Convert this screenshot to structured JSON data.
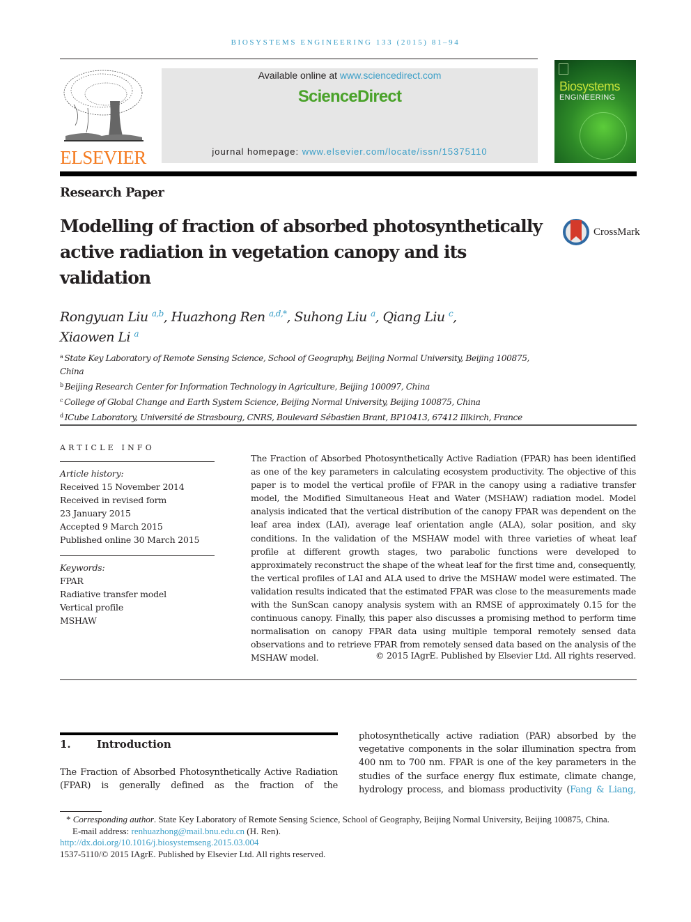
{
  "journal_ref": "BIOSYSTEMS ENGINEERING 133 (2015) 81–94",
  "header": {
    "publisher_logo_text": "ELSEVIER",
    "available_prefix": "Available online at ",
    "available_link": "www.sciencedirect.com",
    "brand": "ScienceDirect",
    "homepage_prefix": "journal homepage: ",
    "homepage_link": "www.elsevier.com/locate/issn/15375110",
    "cover_title_line1": "Biosystems",
    "cover_title_line2": "ENGINEERING"
  },
  "article_type": "Research Paper",
  "title": "Modelling of fraction of absorbed photosynthetically active radiation in vegetation canopy and its validation",
  "crossmark_label": "CrossMark",
  "authors": [
    {
      "name": "Rongyuan Liu",
      "affil": "a,b",
      "sep": ", "
    },
    {
      "name": "Huazhong Ren",
      "affil": "a,d,*",
      "sep": ", "
    },
    {
      "name": "Suhong Liu",
      "affil": "a",
      "sep": ", "
    },
    {
      "name": "Qiang Liu",
      "affil": "c",
      "sep": ","
    },
    {
      "name": "Xiaowen Li",
      "affil": "a",
      "sep": ""
    }
  ],
  "affiliations": [
    {
      "key": "a",
      "text": "State Key Laboratory of Remote Sensing Science, School of Geography, Beijing Normal University, Beijing 100875, China"
    },
    {
      "key": "b",
      "text": "Beijing Research Center for Information Technology in Agriculture, Beijing 100097, China"
    },
    {
      "key": "c",
      "text": "College of Global Change and Earth System Science, Beijing Normal University, Beijing 100875, China"
    },
    {
      "key": "d",
      "text": "ICube Laboratory, Université de Strasbourg, CNRS, Boulevard Sébastien Brant, BP10413, 67412 Illkirch, France"
    }
  ],
  "article_info": {
    "heading": "ARTICLE INFO",
    "history_label": "Article history:",
    "history": [
      "Received 15 November 2014",
      "Received in revised form",
      "23 January 2015",
      "Accepted 9 March 2015",
      "Published online 30 March 2015"
    ],
    "keywords_label": "Keywords:",
    "keywords": [
      "FPAR",
      "Radiative transfer model",
      "Vertical profile",
      "MSHAW"
    ]
  },
  "abstract": {
    "text": "The Fraction of Absorbed Photosynthetically Active Radiation (FPAR) has been identified as one of the key parameters in calculating ecosystem productivity. The objective of this paper is to model the vertical profile of FPAR in the canopy using a radiative transfer model, the Modified Simultaneous Heat and Water (MSHAW) radiation model. Model analysis indicated that the vertical distribution of the canopy FPAR was dependent on the leaf area index (LAI), average leaf orientation angle (ALA), solar position, and sky conditions. In the validation of the MSHAW model with three varieties of wheat leaf profile at different growth stages, two parabolic functions were developed to approximately reconstruct the shape of the wheat leaf for the first time and, consequently, the vertical profiles of LAI and ALA used to drive the MSHAW model were estimated. The validation results indicated that the estimated FPAR was close to the measurements made with the SunScan canopy analysis system with an RMSE of approximately 0.15 for the continuous canopy. Finally, this paper also discusses a promising method to perform time normalisation on canopy FPAR data using multiple temporal remotely sensed data observations and to retrieve FPAR from remotely sensed data based on the analysis of the MSHAW model.",
    "copyright": "© 2015 IAgrE. Published by Elsevier Ltd. All rights reserved."
  },
  "introduction": {
    "number": "1.",
    "heading": "Introduction",
    "col1": "The Fraction of Absorbed Photosynthetically Active Radiation (FPAR) is generally defined as the fraction of the",
    "col2_text": "photosynthetically active radiation (PAR) absorbed by the vegetative components in the solar illumination spectra from 400 nm to 700 nm. FPAR is one of the key parameters in the studies of the surface energy flux estimate, climate change, hydrology process, and biomass productivity (",
    "col2_cite": "Fang & Liang,"
  },
  "footnotes": {
    "corresponding_marker": "* ",
    "corresponding_label": "Corresponding author",
    "corresponding_text": ". State Key Laboratory of Remote Sensing Science, School of Geography, Beijing Normal University, Beijing 100875, China.",
    "email_label": "E-mail address: ",
    "email": "renhuazhong@mail.bnu.edu.cn",
    "email_suffix": " (H. Ren).",
    "doi": "http://dx.doi.org/10.1016/j.biosystemseng.2015.03.004",
    "issn_line": "1537-5110/© 2015 IAgrE. Published by Elsevier Ltd. All rights reserved."
  },
  "colors": {
    "link": "#3a9ec7",
    "elsevier_orange": "#f47b20",
    "sciencedirect_green": "#4aa22a"
  }
}
